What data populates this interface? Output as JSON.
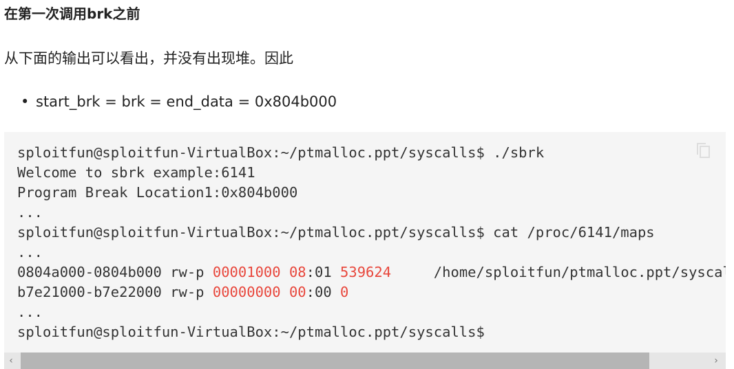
{
  "heading": "在第一次调用brk之前",
  "paragraph": "从下面的输出可以看出，并没有出现堆。因此",
  "bullets": [
    "start_brk = brk = end_data = 0x804b000"
  ],
  "code": {
    "lines": [
      [
        {
          "t": "sploitfun@sploitfun-VirtualBox:~/ptmalloc.ppt/syscalls$ ./sbrk"
        }
      ],
      [
        {
          "t": "Welcome to sbrk example:6141"
        }
      ],
      [
        {
          "t": "Program Break Location1:0x804b000"
        }
      ],
      [
        {
          "t": "..."
        }
      ],
      [
        {
          "t": "sploitfun@sploitfun-VirtualBox:~/ptmalloc.ppt/syscalls$ cat /proc/6141/maps"
        }
      ],
      [
        {
          "t": "..."
        }
      ],
      [
        {
          "t": "0804a000-0804b000 rw-p "
        },
        {
          "t": "00001000",
          "red": true
        },
        {
          "t": " "
        },
        {
          "t": "08",
          "red": true
        },
        {
          "t": ":01 "
        },
        {
          "t": "539624",
          "red": true
        },
        {
          "t": "     /home/sploitfun/ptmalloc.ppt/syscalls/sbrk"
        }
      ],
      [
        {
          "t": "b7e21000-b7e22000 rw-p "
        },
        {
          "t": "00000000",
          "red": true
        },
        {
          "t": " "
        },
        {
          "t": "00",
          "red": true
        },
        {
          "t": ":00 "
        },
        {
          "t": "0",
          "red": true
        }
      ],
      [
        {
          "t": "..."
        }
      ],
      [
        {
          "t": "sploitfun@sploitfun-VirtualBox:~/ptmalloc.ppt/syscalls$"
        }
      ]
    ],
    "copy_icon": "copy-icon",
    "highlight_color": "#e8463b",
    "scroll_left": "‹",
    "scroll_right": "›"
  }
}
